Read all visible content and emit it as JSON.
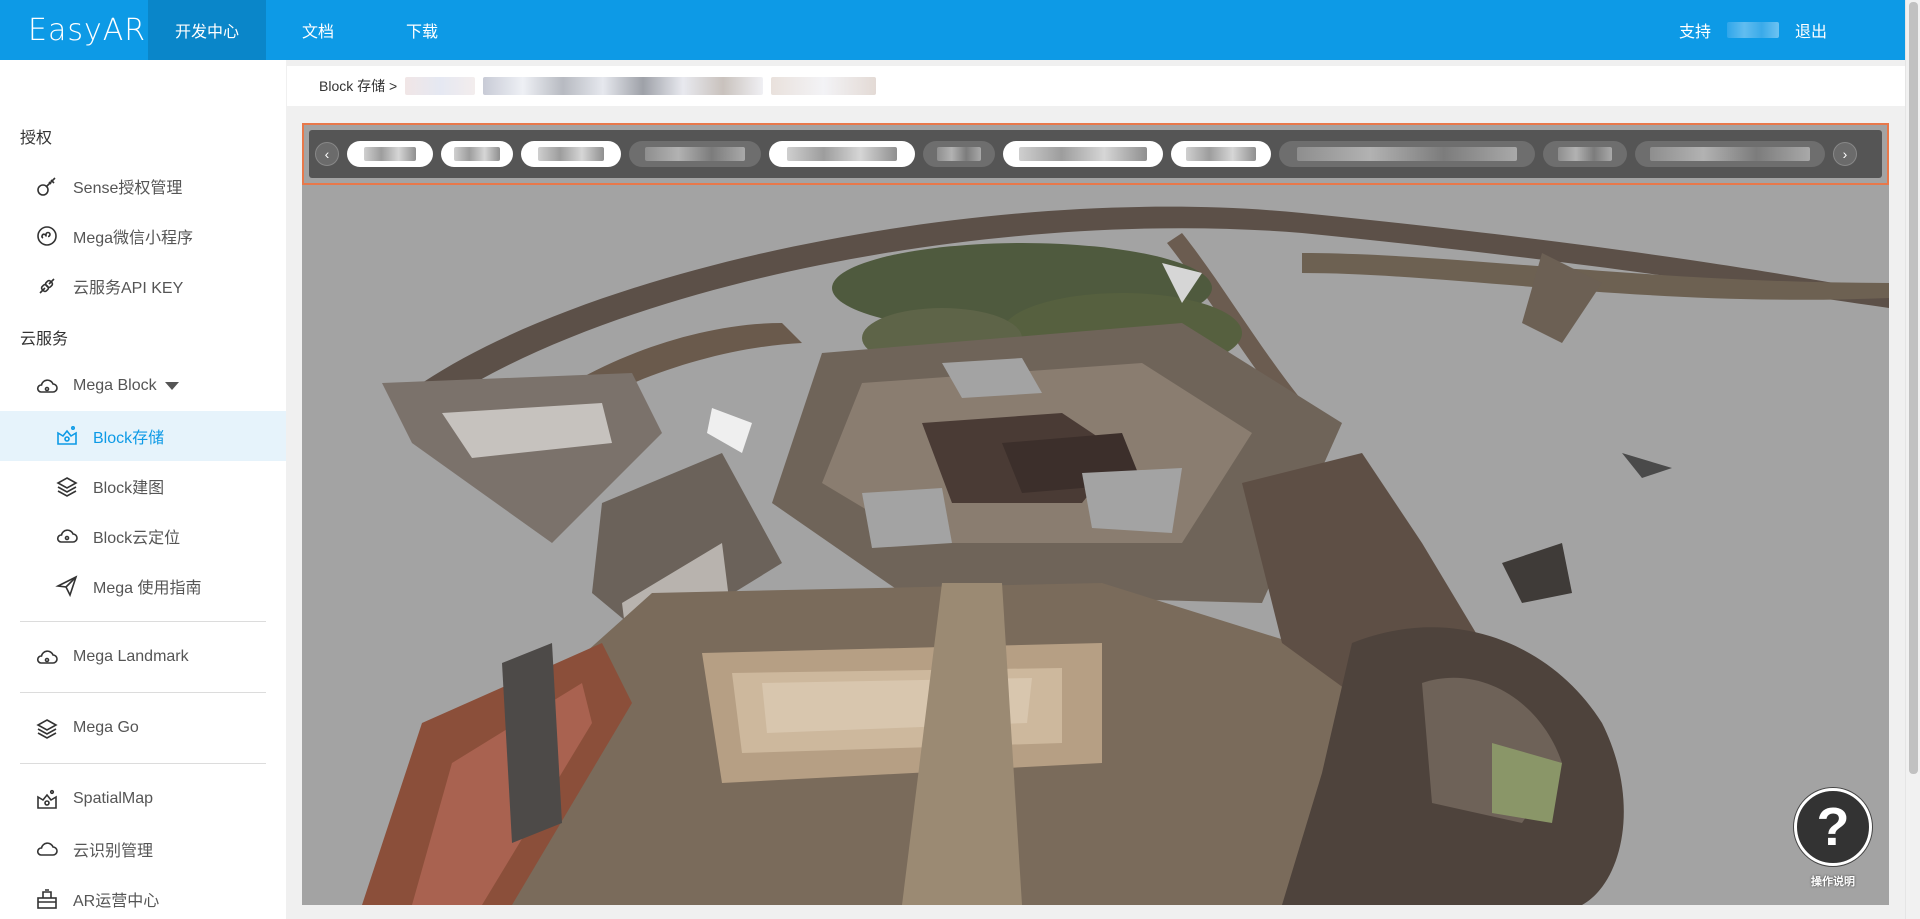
{
  "header": {
    "logo": "EasyAR",
    "nav": [
      "开发中心",
      "文档",
      "下载"
    ],
    "support": "支持",
    "logout": "退出"
  },
  "sidebar": {
    "sections": [
      "授权",
      "云服务"
    ],
    "items": [
      {
        "label": "Sense授权管理",
        "icon": "sense-license-icon"
      },
      {
        "label": "Mega微信小程序",
        "icon": "wechat-miniprogram-icon"
      },
      {
        "label": "云服务API KEY",
        "icon": "api-key-icon"
      },
      {
        "label": "Mega Block",
        "icon": "cloud-icon"
      },
      {
        "label": "Block存储",
        "icon": "block-storage-icon"
      },
      {
        "label": "Block建图",
        "icon": "layers-icon"
      },
      {
        "label": "Block云定位",
        "icon": "cloud-locate-icon"
      },
      {
        "label": "Mega 使用指南",
        "icon": "paper-plane-icon"
      },
      {
        "label": "Mega Landmark",
        "icon": "cloud-icon"
      },
      {
        "label": "Mega Go",
        "icon": "layers-icon"
      },
      {
        "label": "SpatialMap",
        "icon": "spatial-map-icon"
      },
      {
        "label": "云识别管理",
        "icon": "cloud-recognition-icon"
      },
      {
        "label": "AR运营中心",
        "icon": "operation-center-icon"
      }
    ]
  },
  "breadcrumb": {
    "root": "Block 存储 >"
  },
  "help": {
    "icon": "?",
    "label": "操作说明"
  },
  "colors": {
    "brand": "#0d9ae6",
    "active_nav": "#0a86c9",
    "highlight_border": "#e8784a"
  }
}
